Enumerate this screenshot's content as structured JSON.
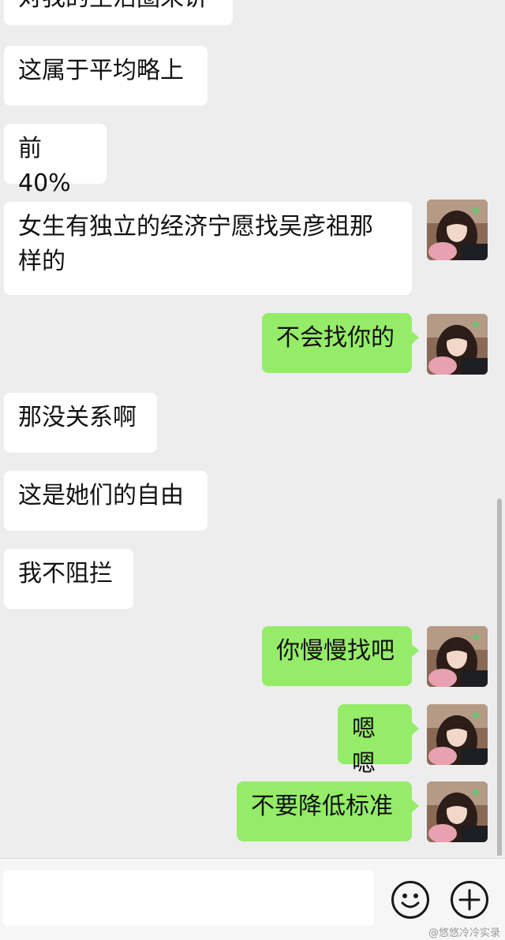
{
  "messages": [
    {
      "side": "left",
      "text": "对我的生活圈来讲"
    },
    {
      "side": "left",
      "text": "这属于平均略上"
    },
    {
      "side": "left",
      "text": "前 40%"
    },
    {
      "side": "left",
      "text": "女生有独立的经济宁愿找吴彦祖那\n样的"
    },
    {
      "side": "right",
      "text": "不会找你的"
    },
    {
      "side": "left",
      "text": "那没关系啊"
    },
    {
      "side": "left",
      "text": "这是她们的自由"
    },
    {
      "side": "left",
      "text": "我不阻拦"
    },
    {
      "side": "right",
      "text": "你慢慢找吧"
    },
    {
      "side": "right",
      "text": "嗯嗯"
    },
    {
      "side": "right",
      "text": "不要降低标准"
    }
  ],
  "input_bar": {
    "placeholder": "",
    "emoji_icon": "smiley-face-icon",
    "add_icon": "plus-circle-icon"
  },
  "watermark": "@悠悠冷冷实录",
  "colors": {
    "background": "#ededed",
    "incoming_bubble": "#ffffff",
    "outgoing_bubble": "#95ec69"
  }
}
